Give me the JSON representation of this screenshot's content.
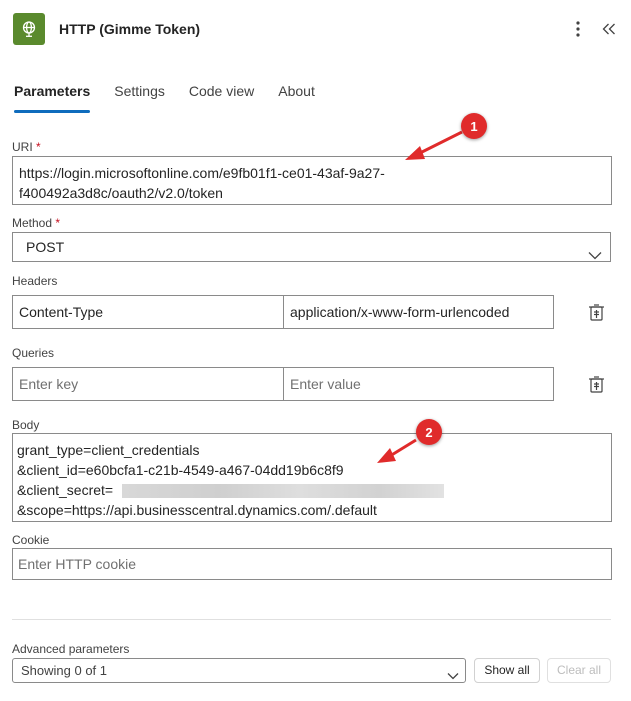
{
  "header": {
    "title": "HTTP (Gimme Token)",
    "app_icon": "globe-icon",
    "more_icon": "more-vertical-icon",
    "collapse_icon": "double-chevron-left-icon",
    "accent_color": "#5a8a2d"
  },
  "tabs": [
    {
      "label": "Parameters",
      "active": true
    },
    {
      "label": "Settings",
      "active": false
    },
    {
      "label": "Code view",
      "active": false
    },
    {
      "label": "About",
      "active": false
    }
  ],
  "uri": {
    "label": "URI",
    "required_mark": "*",
    "line1": "https://login.microsoftonline.com/e9fb01f1-ce01-43af-9a27-",
    "line2": "f400492a3d8c/oauth2/v2.0/token"
  },
  "method": {
    "label": "Method",
    "required_mark": "*",
    "value": "POST"
  },
  "headers": {
    "label": "Headers",
    "key": "Content-Type",
    "value": "application/x-www-form-urlencoded"
  },
  "queries": {
    "label": "Queries",
    "key_placeholder": "Enter key",
    "value_placeholder": "Enter value"
  },
  "body": {
    "label": "Body",
    "line1": "grant_type=client_credentials",
    "line2": "&client_id=e60bcfa1-c21b-4549-a467-04dd19b6c8f9",
    "line3": "&client_secret=",
    "line4": "&scope=https://api.businesscentral.dynamics.com/.default"
  },
  "cookie": {
    "label": "Cookie",
    "placeholder": "Enter HTTP cookie"
  },
  "advanced": {
    "label": "Advanced parameters",
    "selected": "Showing 0 of 1",
    "show_all": "Show all",
    "clear_all": "Clear all"
  },
  "callouts": [
    "1",
    "2"
  ],
  "callout_color": "#e02b2b"
}
